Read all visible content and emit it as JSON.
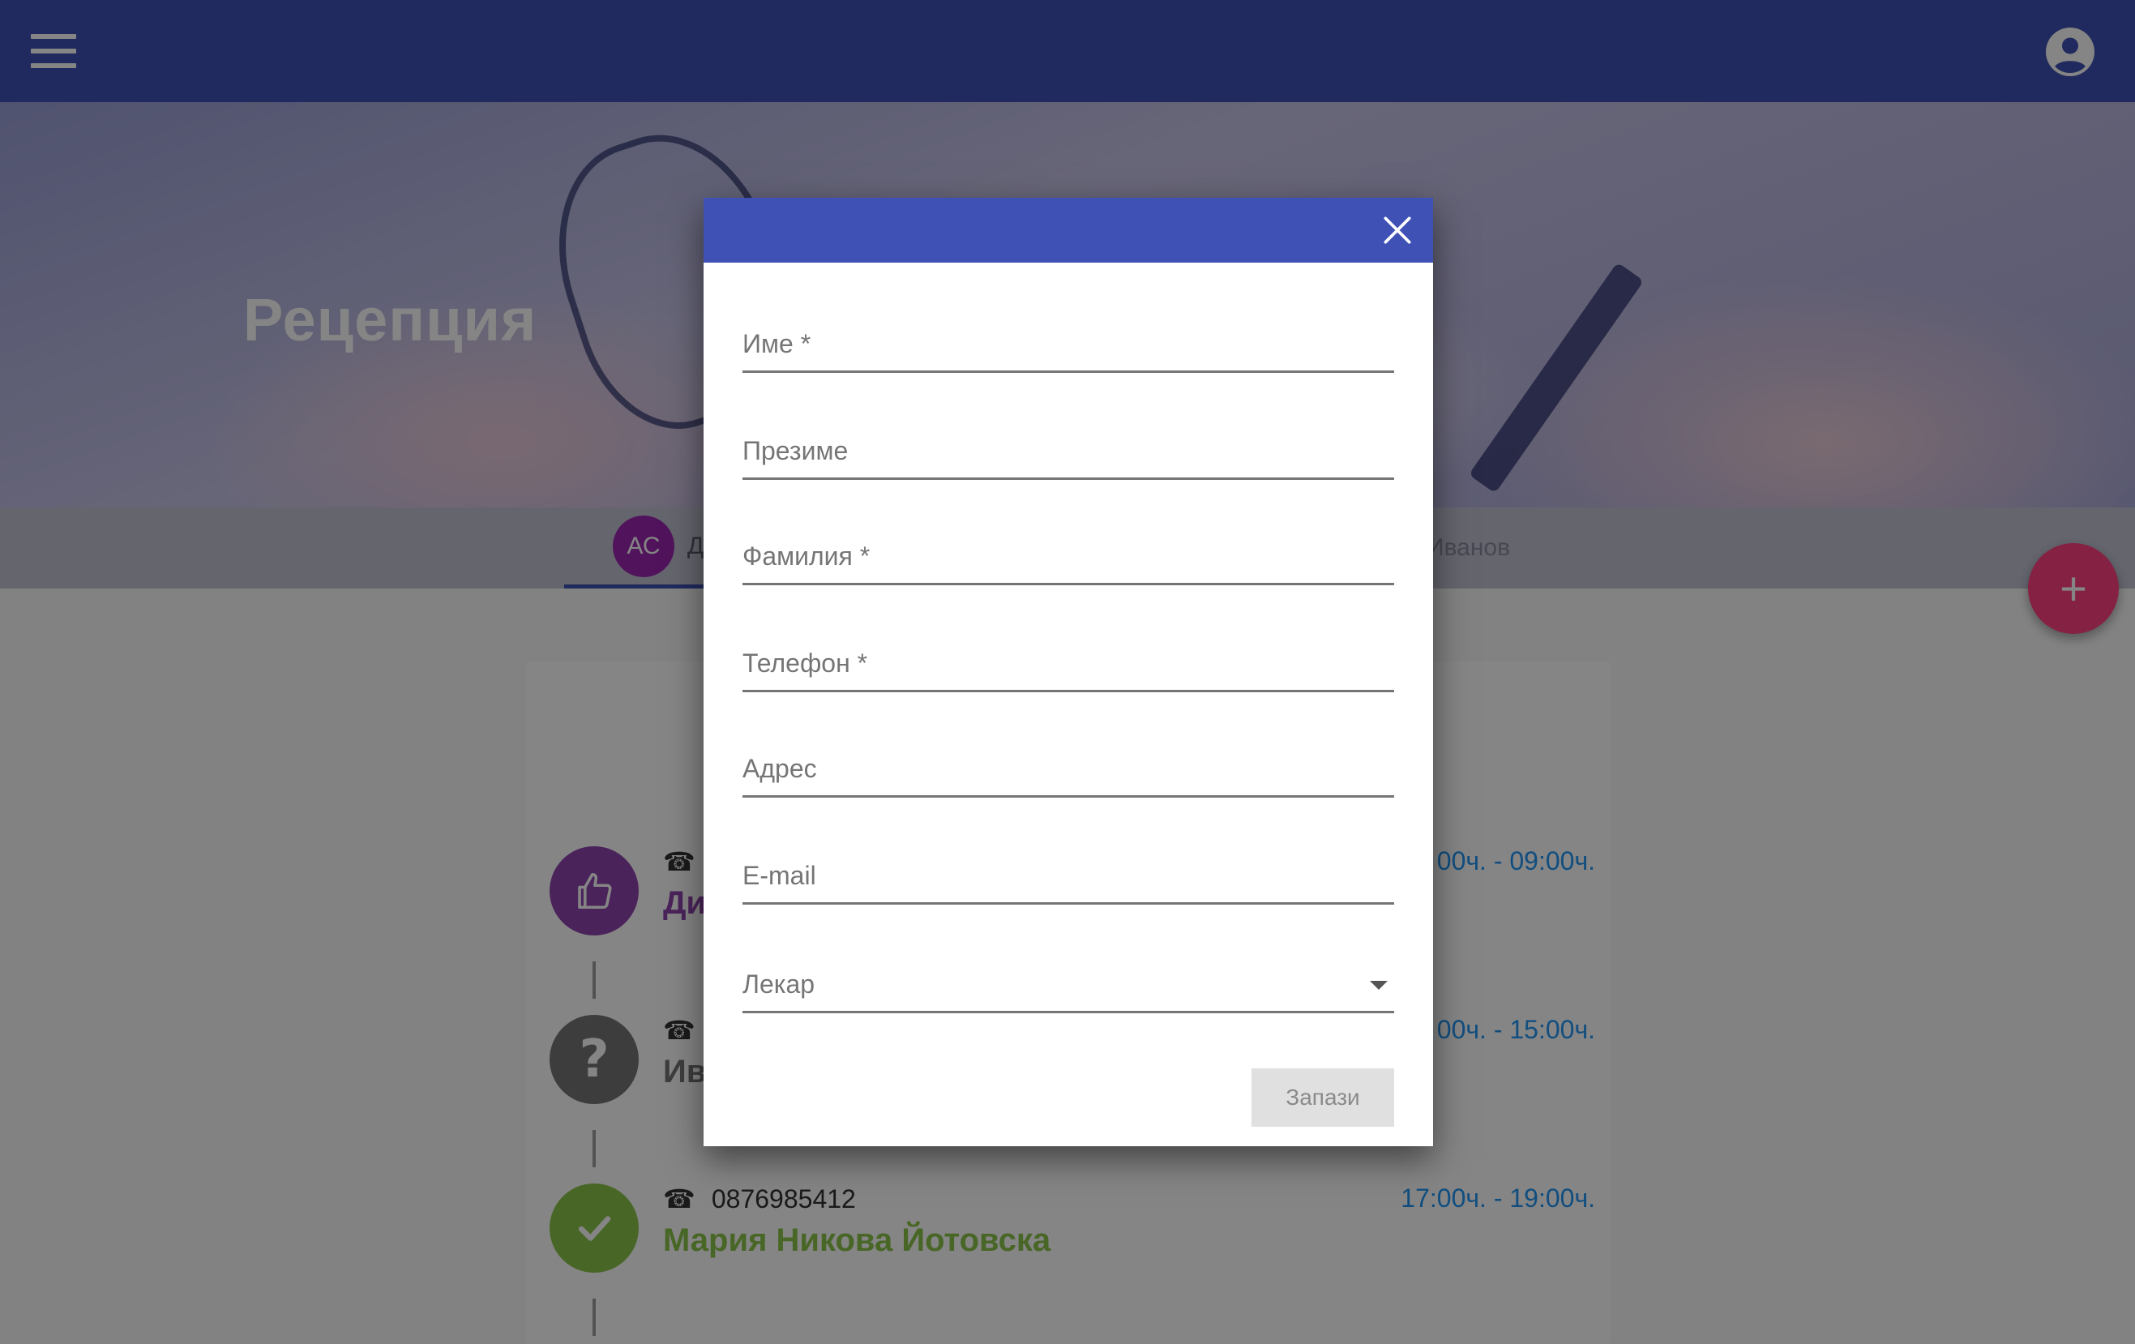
{
  "page": {
    "title": "Рецепция"
  },
  "colors": {
    "primary": "#3f51b5",
    "accent": "#ff4081",
    "avatar": "#9c27b0",
    "confirmed": "#8e44ad",
    "unknown": "#757575",
    "done": "#8bc34a",
    "time": "#2196f3"
  },
  "appbar": {
    "menu_icon": "hamburger-menu-icon",
    "account_icon": "account-circle-icon"
  },
  "tabs": {
    "active": {
      "avatar_initials": "АС",
      "label": "Д"
    },
    "right_label": "Иванов"
  },
  "fab": {
    "label": "+"
  },
  "timeline": [
    {
      "status": "confirmed",
      "icon": "thumb-up-icon",
      "phone": "",
      "name": "Ди",
      "time": "00ч. - 09:00ч."
    },
    {
      "status": "unknown",
      "icon": "question-icon",
      "phone": "",
      "name": "Ив",
      "time": "00ч. - 15:00ч."
    },
    {
      "status": "done",
      "icon": "check-icon",
      "phone": "0876985412",
      "name": "Мария Никова Йотовска",
      "time": "17:00ч. - 19:00ч."
    }
  ],
  "dialog": {
    "close_icon": "close-icon",
    "fields": {
      "first_name": "Име *",
      "middle_name": "Презиме",
      "last_name": "Фамилия *",
      "phone": "Телефон *",
      "address": "Адрес",
      "email": "E-mail",
      "doctor": "Лекар"
    },
    "submit_label": "Запази"
  }
}
